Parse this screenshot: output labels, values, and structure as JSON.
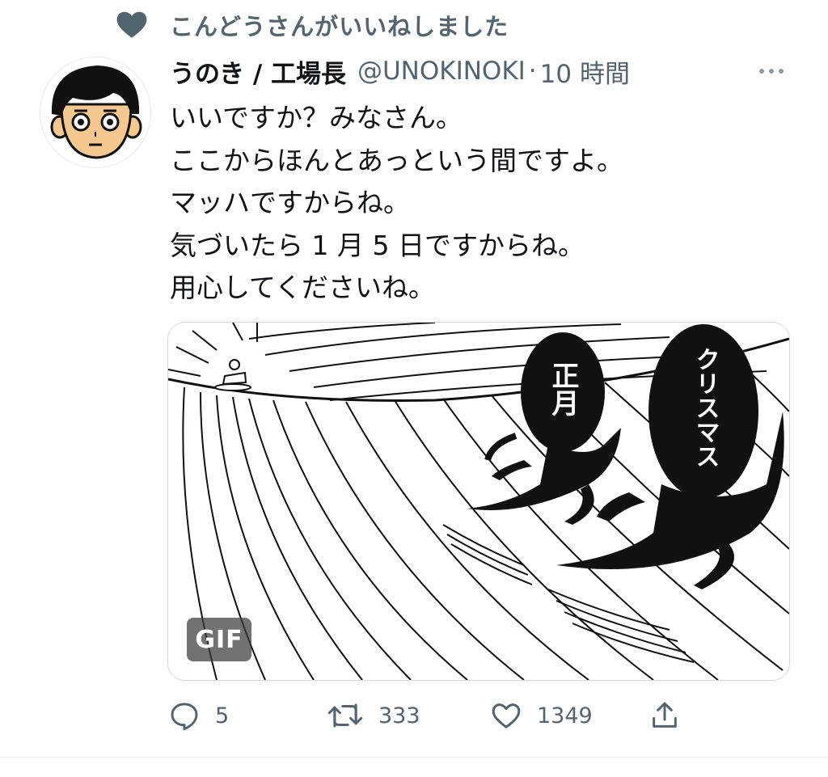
{
  "social_context": {
    "text": "こんどうさんがいいねしました",
    "icon": "heart-filled-icon"
  },
  "tweet": {
    "display_name": "うのき / 工場長",
    "handle": "@UNOKINOKI",
    "separator": "·",
    "time": "10 時間",
    "body_lines": [
      "いいですか？みなさん。",
      "ここからほんとあっという間ですよ。",
      "マッハですからね。",
      "気づいたら 1 月 5 日ですからね。",
      "用心してくださいね。"
    ],
    "media": {
      "badge": "GIF",
      "label_new_year": "正月",
      "label_christmas": "クリスマス"
    },
    "actions": {
      "reply_count": "5",
      "retweet_count": "333",
      "like_count": "1349"
    }
  },
  "colors": {
    "secondary_text": "#536471",
    "primary_text": "#0f1419",
    "border": "#cfd9de"
  }
}
